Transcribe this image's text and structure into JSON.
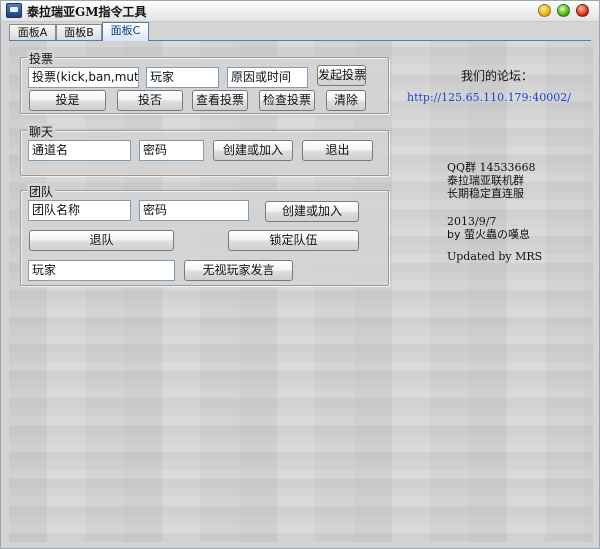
{
  "window": {
    "title": "泰拉瑞亚GM指令工具"
  },
  "tabs": [
    {
      "label": "面板A"
    },
    {
      "label": "面板B"
    },
    {
      "label": "面板C"
    }
  ],
  "vote": {
    "title": "投票",
    "vote_type_field": "投票(kick,ban,mute,",
    "player_field": "玩家",
    "reason_field": "原因或时间",
    "start_vote_button": "发起投票",
    "vote_yes_button": "投是",
    "vote_no_button": "投否",
    "view_vote_button": "查看投票",
    "check_vote_button": "检查投票",
    "clear_button": "清除"
  },
  "chat": {
    "title": "聊天",
    "channel_field": "通道名",
    "password_field": "密码",
    "create_join_button": "创建或加入",
    "exit_button": "退出"
  },
  "team": {
    "title": "团队",
    "team_name_field": "团队名称",
    "password_field": "密码",
    "create_join_button": "创建或加入",
    "leave_team_button": "退队",
    "lock_team_button": "锁定队伍",
    "player_field": "玩家",
    "ignore_player_button": "无视玩家发言"
  },
  "info": {
    "forum_label": "我们的论坛：",
    "forum_url": "http://125.65.110.179:40002/",
    "qq_group": "QQ群 14533668",
    "group_name": "泰拉瑞亚联机群",
    "server_desc": "长期稳定直连服",
    "date": "2013/9/7",
    "author": "by 萤火蟲の嘆息",
    "updated": "Updated by MRS"
  }
}
